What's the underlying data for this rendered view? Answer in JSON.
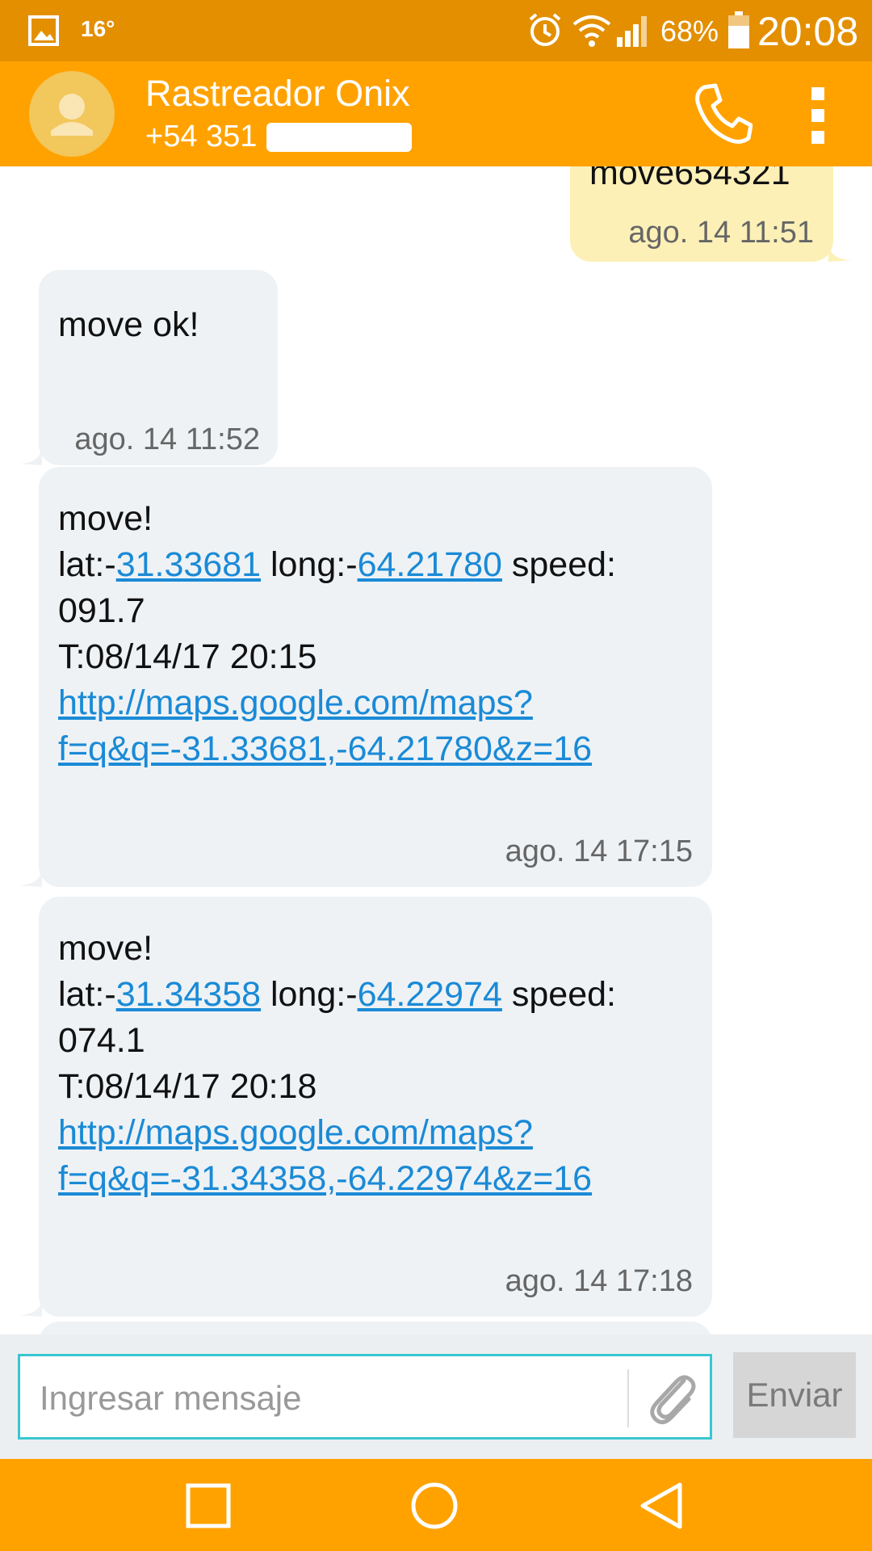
{
  "status_bar": {
    "temperature": "16°",
    "battery_percent": "68%",
    "time": "20:08"
  },
  "header": {
    "contact_name": "Rastreador Onix",
    "contact_number": "+54 351"
  },
  "messages": [
    {
      "direction": "outgoing",
      "text_partial": "move654321",
      "timestamp": "ago. 14 11:51"
    },
    {
      "direction": "incoming",
      "text": "move ok!",
      "timestamp": "ago. 14 11:52"
    },
    {
      "direction": "incoming",
      "title": "move!",
      "lat_prefix": "lat:-",
      "lat": "31.33681",
      "long_prefix": " long:-",
      "long": "64.21780",
      "speed_label": " speed:",
      "speed": "091.7",
      "time_line": "T:08/14/17 20:15",
      "url_line1": "http://maps.google.com/maps?",
      "url_line2": "f=q&q=-31.33681,-64.21780&z=16",
      "timestamp": "ago. 14 17:15"
    },
    {
      "direction": "incoming",
      "title": "move!",
      "lat_prefix": "lat:-",
      "lat": "31.34358",
      "long_prefix": " long:-",
      "long": "64.22974",
      "speed_label": " speed:",
      "speed": "074.1",
      "time_line": "T:08/14/17 20:18",
      "url_line1": "http://maps.google.com/maps?",
      "url_line2": "f=q&q=-31.34358,-64.22974&z=16",
      "timestamp": "ago. 14 17:18"
    }
  ],
  "composer": {
    "placeholder": "Ingresar mensaje",
    "send_label": "Enviar"
  },
  "icons": {
    "status": [
      "gallery-icon",
      "alarm-icon",
      "wifi-icon",
      "signal-icon",
      "battery-icon"
    ],
    "header": [
      "avatar-icon",
      "phone-icon",
      "more-vert-icon"
    ],
    "composer": [
      "paperclip-icon"
    ],
    "nav": [
      "recent-apps-icon",
      "home-icon",
      "back-icon"
    ]
  },
  "colors": {
    "status_bar": "#e38f00",
    "app_bar": "#ffa200",
    "incoming_bubble": "#eef2f5",
    "outgoing_bubble": "#fcf0b7",
    "link": "#1a8ad6",
    "input_border": "#39c7d0"
  }
}
